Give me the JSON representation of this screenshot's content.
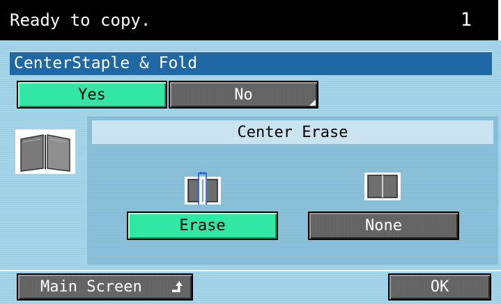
{
  "header": {
    "status": "Ready to copy.",
    "copy_count": "1"
  },
  "section": {
    "title": "CenterStaple & Fold"
  },
  "toggle": {
    "yes_label": "Yes",
    "no_label": "No",
    "selected": "Yes"
  },
  "center_erase": {
    "title": "Center Erase",
    "erase_label": "Erase",
    "none_label": "None",
    "selected": "Erase"
  },
  "footer": {
    "main_screen_label": "Main Screen",
    "ok_label": "OK"
  },
  "colors": {
    "selected": "#32e6a4",
    "unselected": "#606060",
    "title_bar": "#1f68a3",
    "background": "#9fd1e6"
  }
}
